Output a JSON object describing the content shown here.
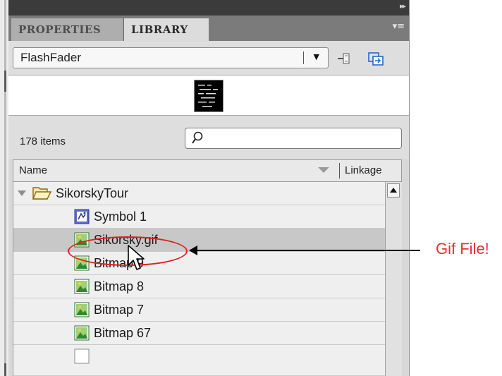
{
  "tabs": {
    "properties": "PROPERTIES",
    "library": "LIBRARY"
  },
  "library_select": {
    "value": "FlashFader"
  },
  "item_count": "178 items",
  "search": {
    "placeholder": ""
  },
  "columns": {
    "name": "Name",
    "linkage": "Linkage"
  },
  "items": [
    {
      "label": "SikorskyTour",
      "type": "folder-open",
      "expanded": true
    },
    {
      "label": "Symbol 1",
      "type": "movieclip"
    },
    {
      "label": "Sikorsky.gif",
      "type": "bitmap",
      "selected": true
    },
    {
      "label": "Bitmap 9",
      "type": "bitmap"
    },
    {
      "label": "Bitmap 8",
      "type": "bitmap"
    },
    {
      "label": "Bitmap 7",
      "type": "bitmap"
    },
    {
      "label": "Bitmap 67",
      "type": "bitmap"
    }
  ],
  "annotation": {
    "text": "Gif File!",
    "color": "#e53030"
  },
  "colors": {
    "tab_active": "#dcdcdc",
    "tab_inactive": "#aeaeae",
    "selection": "#c8c8c8"
  },
  "icons": [
    "panel-expand-icon",
    "panel-menu-icon",
    "pin-icon",
    "new-library-icon",
    "search-icon",
    "folder-open-icon",
    "movieclip-symbol-icon",
    "bitmap-icon",
    "scroll-up-icon",
    "mouse-cursor-icon"
  ]
}
